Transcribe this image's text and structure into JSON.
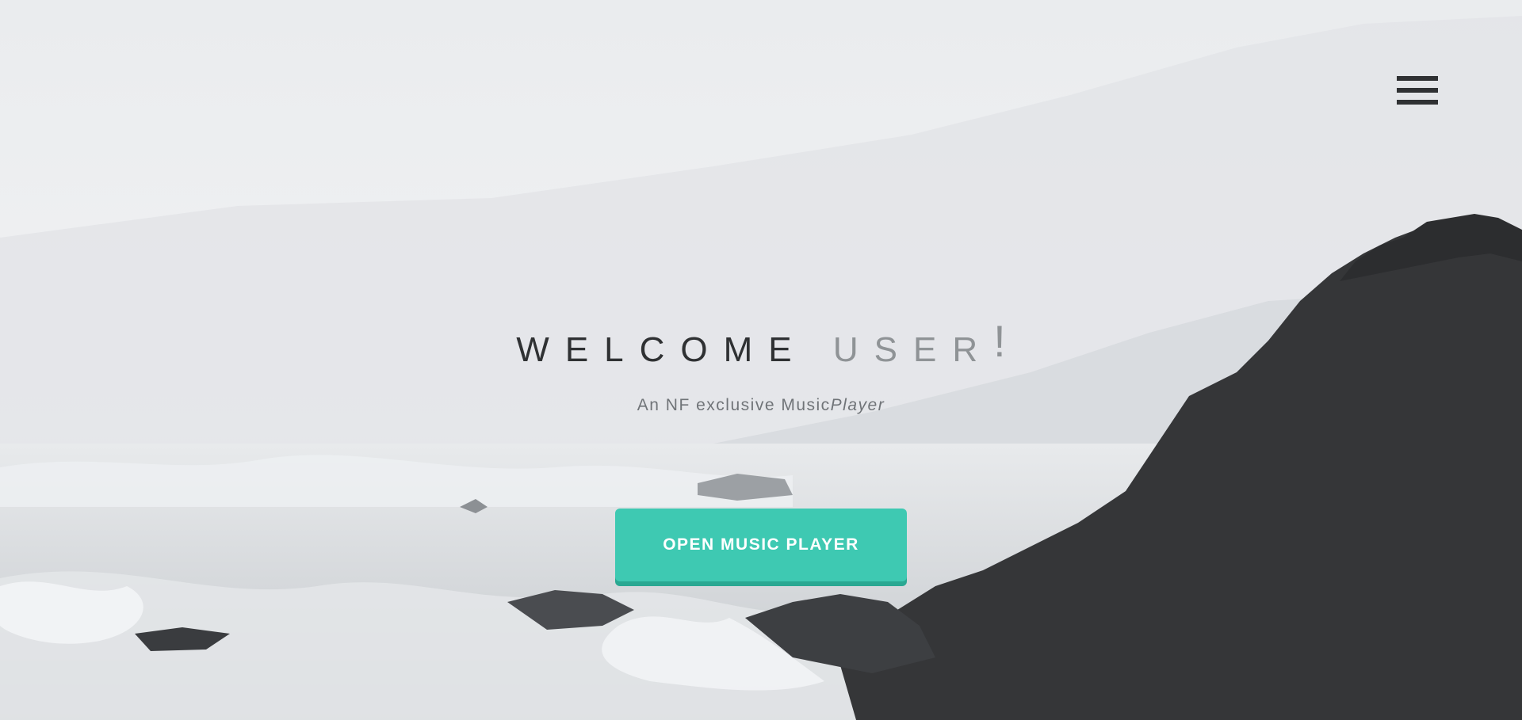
{
  "hero": {
    "title_main": "WELCOME",
    "title_accent": "USER",
    "title_bang": "!",
    "subtitle_main": "An NF exclusive Music",
    "subtitle_italic": "Player"
  },
  "cta": {
    "label": "OPEN MUSIC PLAYER"
  },
  "icons": {
    "menu": "hamburger-menu-icon"
  },
  "colors": {
    "accent": "#3ec9b2",
    "dark_text": "#2f3133",
    "muted_text": "#8f9396"
  }
}
